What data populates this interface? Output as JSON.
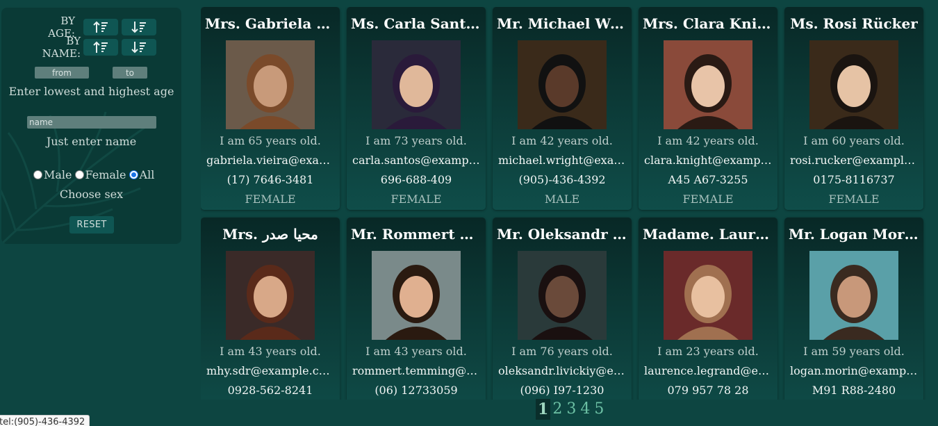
{
  "sidebar": {
    "sort_by_age_label": "BY AGE:",
    "sort_by_name_label": "BY NAME:",
    "age_from_placeholder": "from",
    "age_to_placeholder": "to",
    "age_caption": "Enter lowest and highest age",
    "name_placeholder": "name",
    "name_caption": "Just enter name",
    "sex_options": [
      "Male",
      "Female",
      "All"
    ],
    "sex_selected": "All",
    "sex_caption": "Choose sex",
    "reset_label": "RESET"
  },
  "cards": [
    {
      "name": "Mrs. Gabriela Vieira",
      "age": "I am 65 years old.",
      "email": "gabriela.vieira@example.com",
      "phone": "(17) 7646-3481",
      "sex": "FEMALE"
    },
    {
      "name": "Ms. Carla Santos",
      "age": "I am 73 years old.",
      "email": "carla.santos@example.com",
      "phone": "696-688-409",
      "sex": "FEMALE"
    },
    {
      "name": "Mr. Michael Wright",
      "age": "I am 42 years old.",
      "email": "michael.wright@example.com",
      "phone": "(905)-436-4392",
      "sex": "MALE"
    },
    {
      "name": "Mrs. Clara Knight",
      "age": "I am 42 years old.",
      "email": "clara.knight@example.com",
      "phone": "A45 A67-3255",
      "sex": "FEMALE"
    },
    {
      "name": "Ms. Rosi Rücker",
      "age": "I am 60 years old.",
      "email": "rosi.rucker@example.com",
      "phone": "0175-8116737",
      "sex": "FEMALE"
    },
    {
      "name": "Mrs. محیا صدر",
      "age": "I am 43 years old.",
      "email": "mhy.sdr@example.com",
      "phone": "0928-562-8241",
      "sex": "FEMALE"
    },
    {
      "name": "Mr. Rommert Temming",
      "age": "I am 43 years old.",
      "email": "rommert.temming@example.com",
      "phone": "(06) 12733059",
      "sex": "MALE"
    },
    {
      "name": "Mr. Oleksandr Livickiy",
      "age": "I am 76 years old.",
      "email": "oleksandr.livickiy@example.com",
      "phone": "(096) I97-1230",
      "sex": "MALE"
    },
    {
      "name": "Madame. Laurence Legrand",
      "age": "I am 23 years old.",
      "email": "laurence.legrand@example.com",
      "phone": "079 957 78 28",
      "sex": "FEMALE"
    },
    {
      "name": "Mr. Logan Morin",
      "age": "I am 59 years old.",
      "email": "logan.morin@example.com",
      "phone": "M91 R88-2480",
      "sex": "MALE"
    }
  ],
  "pagination": {
    "pages": [
      "1",
      "2",
      "3",
      "4",
      "5"
    ],
    "current": "1"
  },
  "tooltip": "tel:(905)-436-4392"
}
